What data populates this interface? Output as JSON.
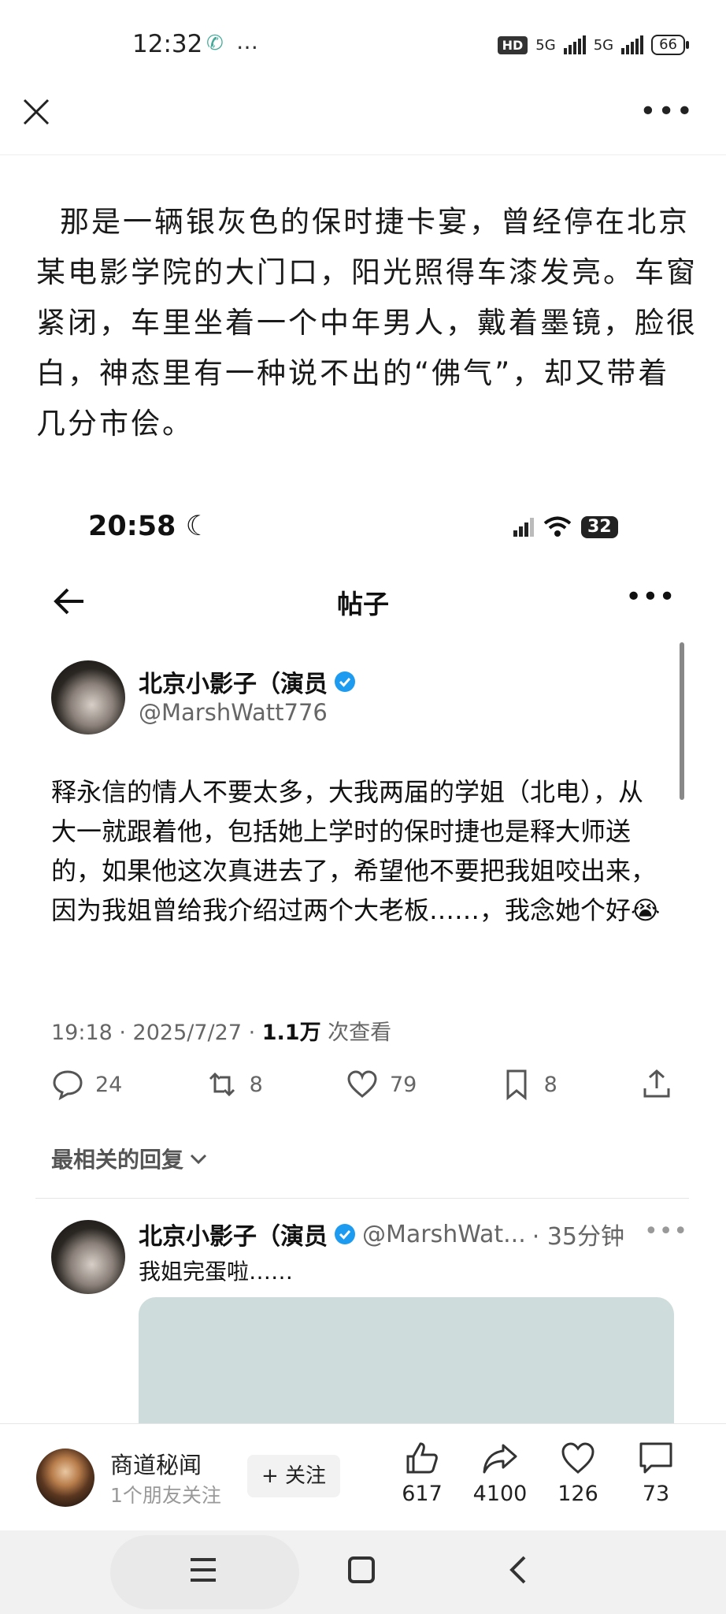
{
  "status_bar": {
    "time": "12:32",
    "extra": "…",
    "hd": "HD",
    "net1": "5G",
    "net2": "5G",
    "battery": "66"
  },
  "article": {
    "text": "那是一辆银灰色的保时捷卡宴，曾经停在北京某电影学院的大门口，阳光照得车漆发亮。车窗紧闭，车里坐着一个中年男人，戴着墨镜，脸很白，神态里有一种说不出的“佛气”，却又带着几分市侩。"
  },
  "embedded": {
    "time": "20:58",
    "battery": "32",
    "title": "帖子",
    "post": {
      "author": "北京小影子（演员",
      "handle": "@MarshWatt776",
      "text": "释永信的情人不要太多，大我两届的学姐（北电），从大一就跟着他，包括她上学时的保时捷也是释大师送的，如果他这次真进去了，希望他不要把我姐咬出来，因为我姐曾给我介绍过两个大老板……，我念她个好😭",
      "meta_time": "19:18 · 2025/7/27 · ",
      "views_count": "1.1万",
      "views_label": " 次查看",
      "replies": "24",
      "retweets": "8",
      "likes": "79",
      "bookmarks": "8"
    },
    "relevant_label": "最相关的回复",
    "reply": {
      "author": "北京小影子（演员",
      "handle": "@MarshWat...",
      "time": "· 35分钟",
      "text": "我姐完蛋啦……"
    }
  },
  "bottom_bar": {
    "account": "商道秘闻",
    "sub": "1个朋友关注",
    "follow": "+ 关注",
    "likes": "617",
    "shares": "4100",
    "favorites": "126",
    "comments": "73"
  }
}
